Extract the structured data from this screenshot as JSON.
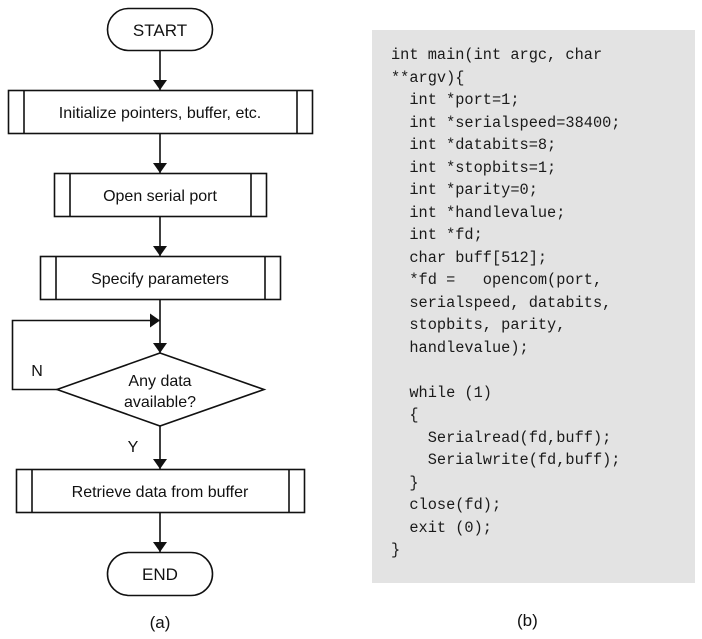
{
  "flowchart": {
    "start_label": "START",
    "steps": [
      "Initialize pointers, buffer, etc.",
      "Open serial port",
      "Specify parameters"
    ],
    "decision": {
      "line1": "Any data",
      "line2": "available?",
      "no_label": "N",
      "yes_label": "Y"
    },
    "retrieve_label": "Retrieve data from buffer",
    "end_label": "END",
    "caption": "(a)"
  },
  "code": {
    "lines": [
      "int main(int argc, char",
      "**argv){",
      "  int *port=1;",
      "  int *serialspeed=38400;",
      "  int *databits=8;",
      "  int *stopbits=1;",
      "  int *parity=0;",
      "  int *handlevalue;",
      "  int *fd;",
      "  char buff[512];",
      "  *fd =   opencom(port,",
      "  serialspeed, databits,",
      "  stopbits, parity,",
      "  handlevalue);",
      "",
      "  while (1)",
      "  {",
      "    Serialread(fd,buff);",
      "    Serialwrite(fd,buff);",
      "  }",
      "  close(fd);",
      "  exit (0);",
      "}"
    ],
    "background": "#e3e3e3",
    "caption": "(b)"
  }
}
